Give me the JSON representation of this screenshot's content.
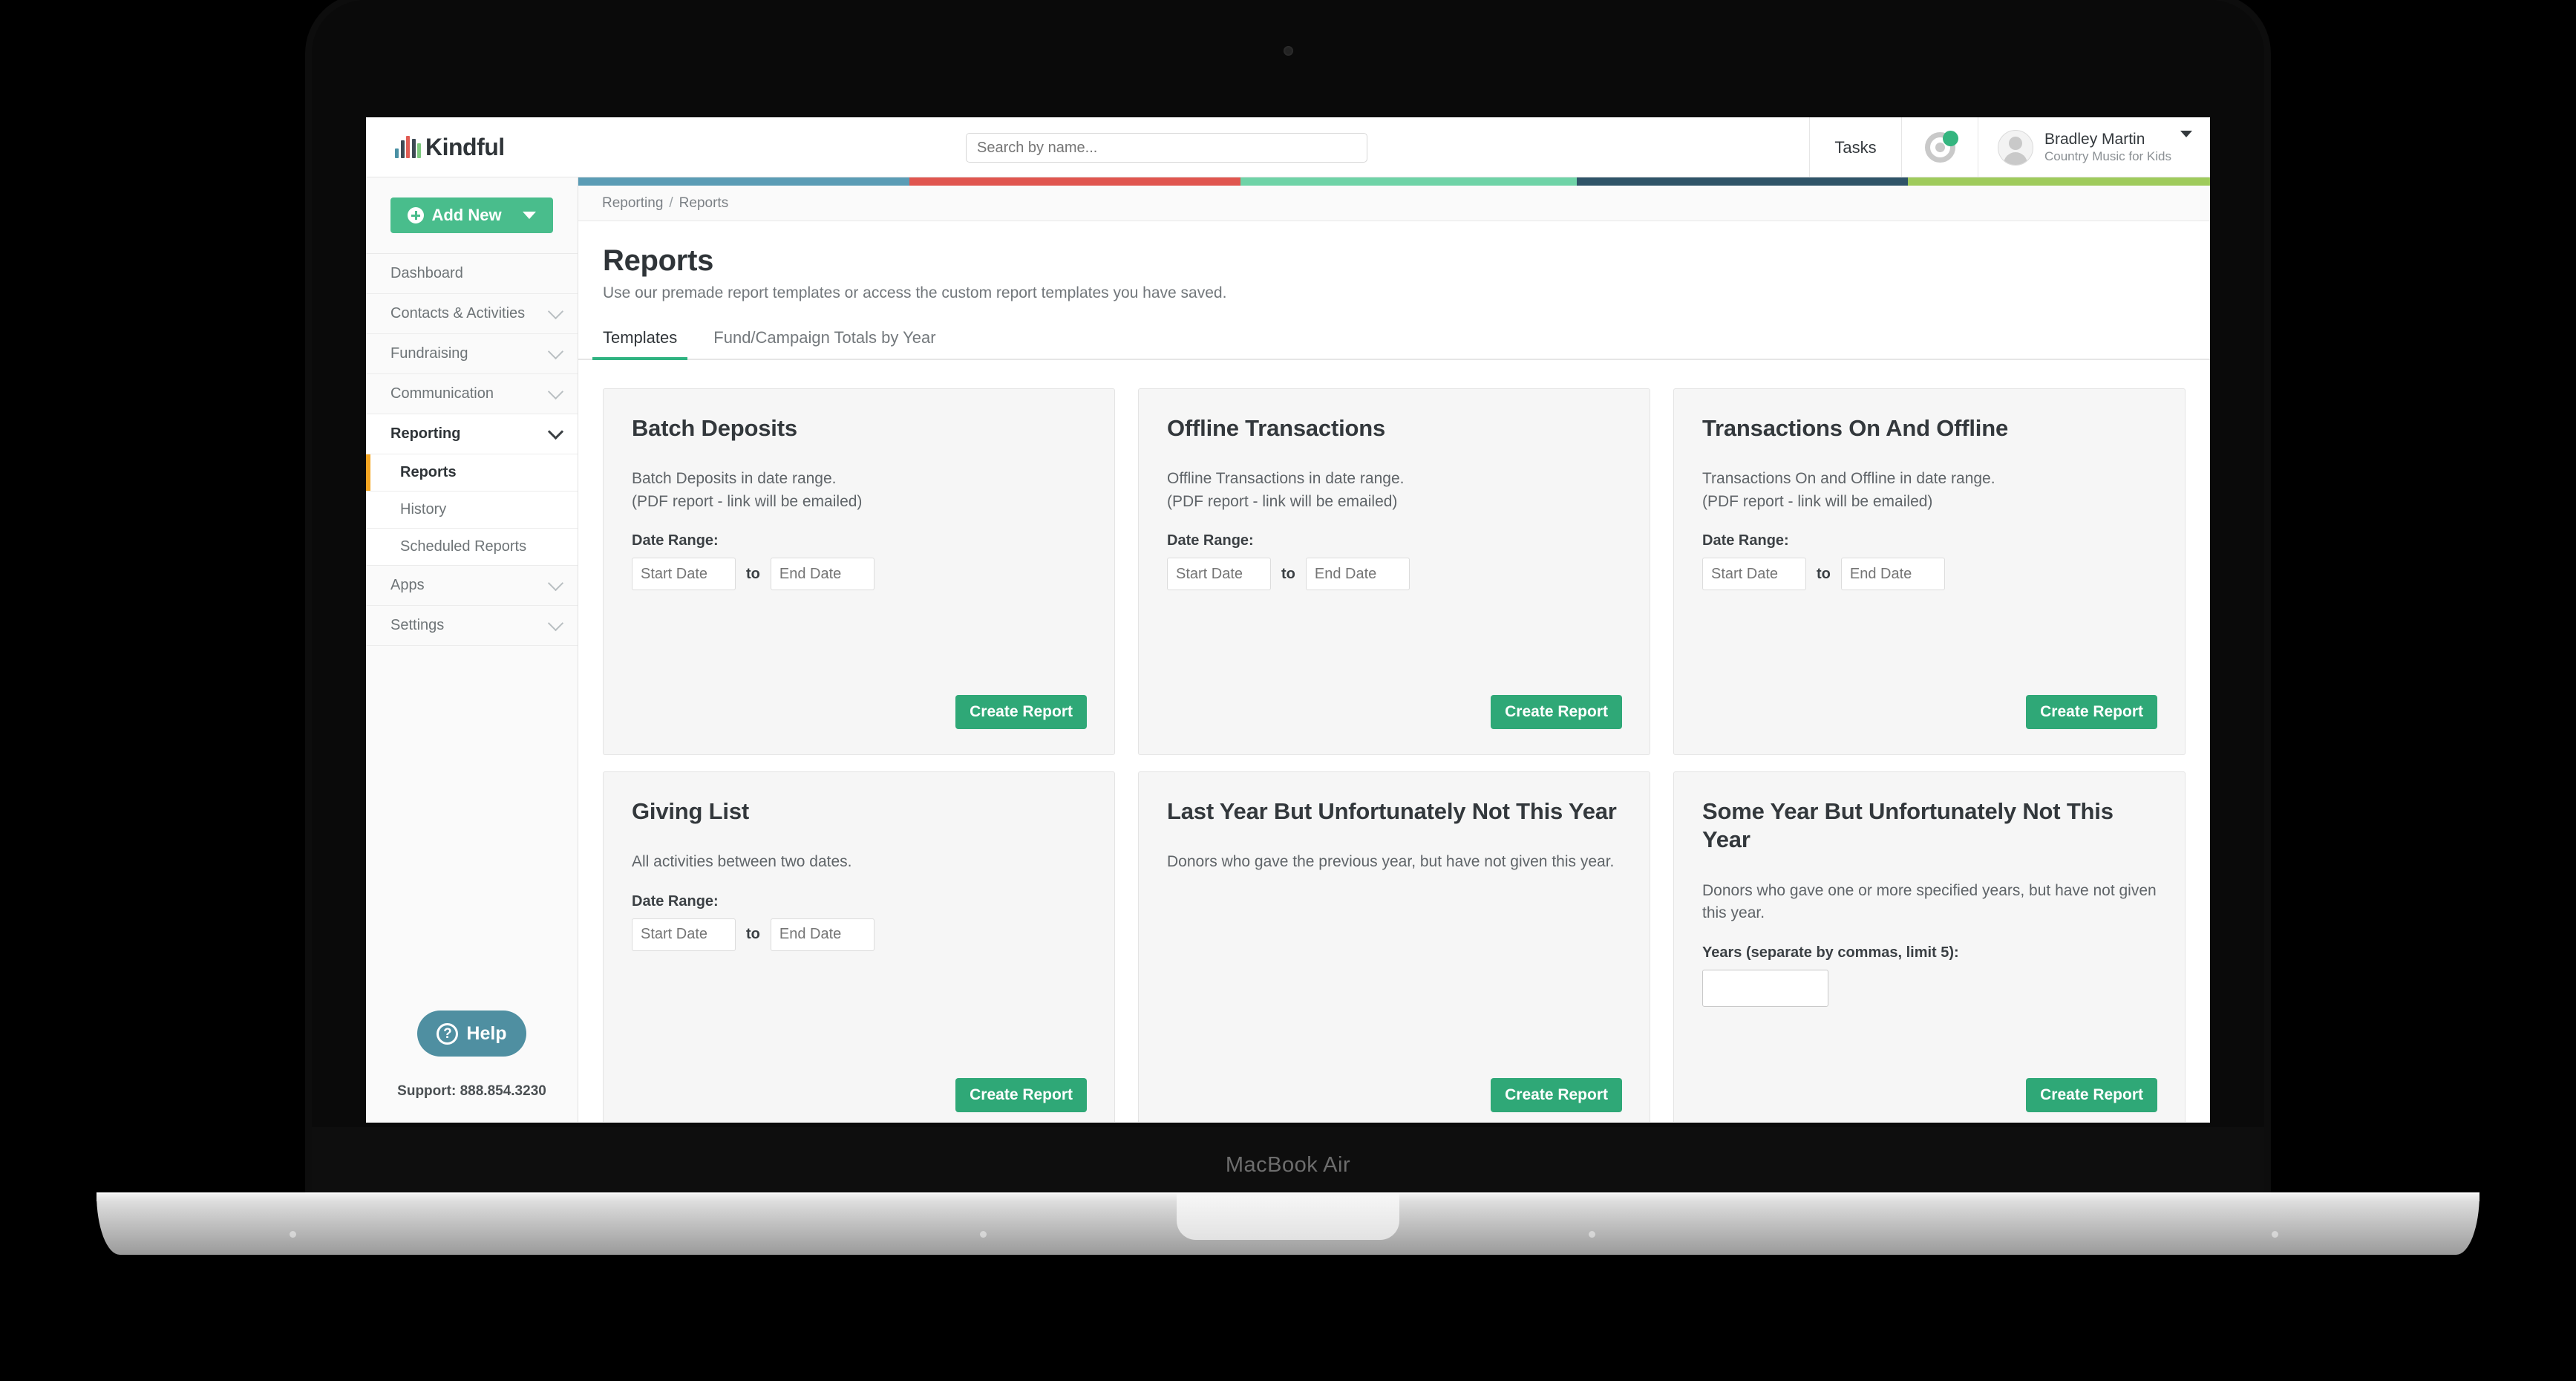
{
  "device": {
    "label": "MacBook Air"
  },
  "header": {
    "brand_name": "Kindful",
    "search_placeholder": "Search by name...",
    "tasks_label": "Tasks",
    "user_name": "Bradley Martin",
    "user_org": "Country Music for Kids"
  },
  "sidebar": {
    "add_new_label": "Add New",
    "items": [
      {
        "label": "Dashboard",
        "expandable": false
      },
      {
        "label": "Contacts & Activities",
        "expandable": true
      },
      {
        "label": "Fundraising",
        "expandable": true
      },
      {
        "label": "Communication",
        "expandable": true
      },
      {
        "label": "Reporting",
        "expandable": true,
        "active": true
      },
      {
        "label": "Apps",
        "expandable": true
      },
      {
        "label": "Settings",
        "expandable": true
      }
    ],
    "sub_items": [
      {
        "label": "Reports",
        "selected": true
      },
      {
        "label": "History",
        "selected": false
      },
      {
        "label": "Scheduled Reports",
        "selected": false
      }
    ],
    "help_label": "Help",
    "support_label": "Support: 888.854.3230"
  },
  "stripe_colors": [
    "#5b9cb5",
    "#e0564f",
    "#6fd3a7",
    "#2f5468",
    "#9fcb5c"
  ],
  "breadcrumb": {
    "parent": "Reporting",
    "separator": "/",
    "current": "Reports"
  },
  "page": {
    "title": "Reports",
    "subtitle": "Use our premade report templates or access the custom report templates you have saved."
  },
  "tabs": [
    {
      "label": "Templates",
      "active": true
    },
    {
      "label": "Fund/Campaign Totals by Year",
      "active": false
    }
  ],
  "labels": {
    "date_range": "Date Range:",
    "start_date_placeholder": "Start Date",
    "end_date_placeholder": "End Date",
    "to": "to",
    "years_label": "Years (separate by commas, limit 5):",
    "years_value": "",
    "create_report": "Create Report"
  },
  "cards": [
    {
      "title": "Batch Deposits",
      "description": "Batch Deposits in date range.\n(PDF report - link will be emailed)",
      "field_type": "date_range"
    },
    {
      "title": "Offline Transactions",
      "description": "Offline Transactions in date range.\n(PDF report - link will be emailed)",
      "field_type": "date_range"
    },
    {
      "title": "Transactions On And Offline",
      "description": "Transactions On and Offline in date range.\n(PDF report - link will be emailed)",
      "field_type": "date_range"
    },
    {
      "title": "Giving List",
      "description": "All activities between two dates.",
      "field_type": "date_range"
    },
    {
      "title": "Last Year But Unfortunately Not This Year",
      "description": "Donors who gave the previous year, but have not given this year.",
      "field_type": "none"
    },
    {
      "title": "Some Year But Unfortunately Not This Year",
      "description": "Donors who gave one or more specified years, but have not given this year.",
      "field_type": "years"
    }
  ],
  "colors": {
    "brand_green": "#49bd8c",
    "button_green": "#2fa877",
    "tab_underline": "#2fb381",
    "active_marker": "#f5a623",
    "help_teal": "#4f8fa1",
    "notification_green": "#34b57f"
  }
}
